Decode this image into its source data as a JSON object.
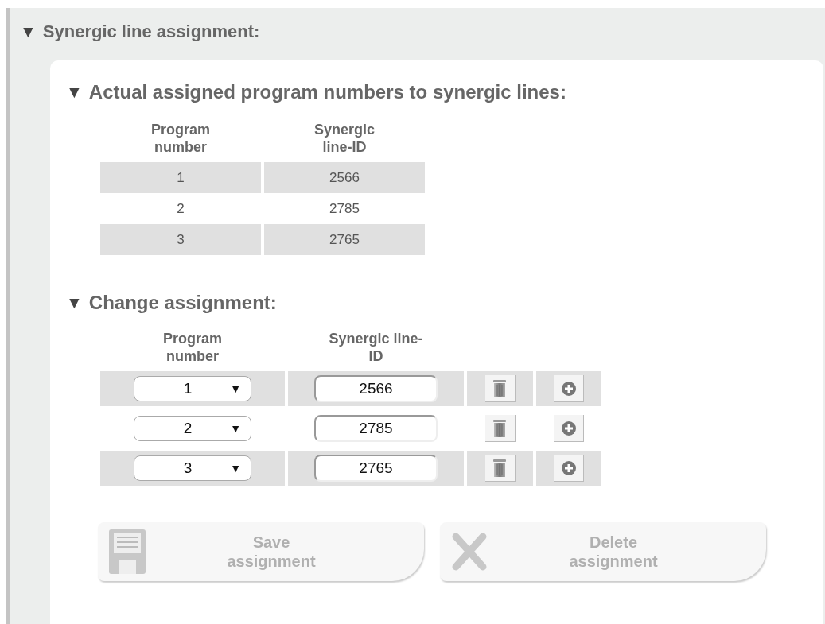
{
  "section": {
    "toggle": "▼",
    "title": "Synergic line assignment:"
  },
  "current": {
    "toggle": "▼",
    "title": "Actual assigned program numbers to synergic lines:",
    "columns": [
      "Program number",
      "Synergic line-ID"
    ],
    "rows": [
      {
        "program": "1",
        "line_id": "2566"
      },
      {
        "program": "2",
        "line_id": "2785"
      },
      {
        "program": "3",
        "line_id": "2765"
      }
    ]
  },
  "change": {
    "toggle": "▼",
    "title": "Change assignment:",
    "columns": [
      "Program number",
      "Synergic line-ID"
    ],
    "rows": [
      {
        "program": "1",
        "arrow": "▼",
        "line_id": "2566"
      },
      {
        "program": "2",
        "arrow": "▼",
        "line_id": "2785"
      },
      {
        "program": "3",
        "arrow": "▼",
        "line_id": "2765"
      }
    ]
  },
  "buttons": [
    {
      "kind": "save",
      "label": "Save assignment",
      "disabled": true
    },
    {
      "kind": "delete",
      "label": "Delete assignment",
      "disabled": true
    }
  ]
}
